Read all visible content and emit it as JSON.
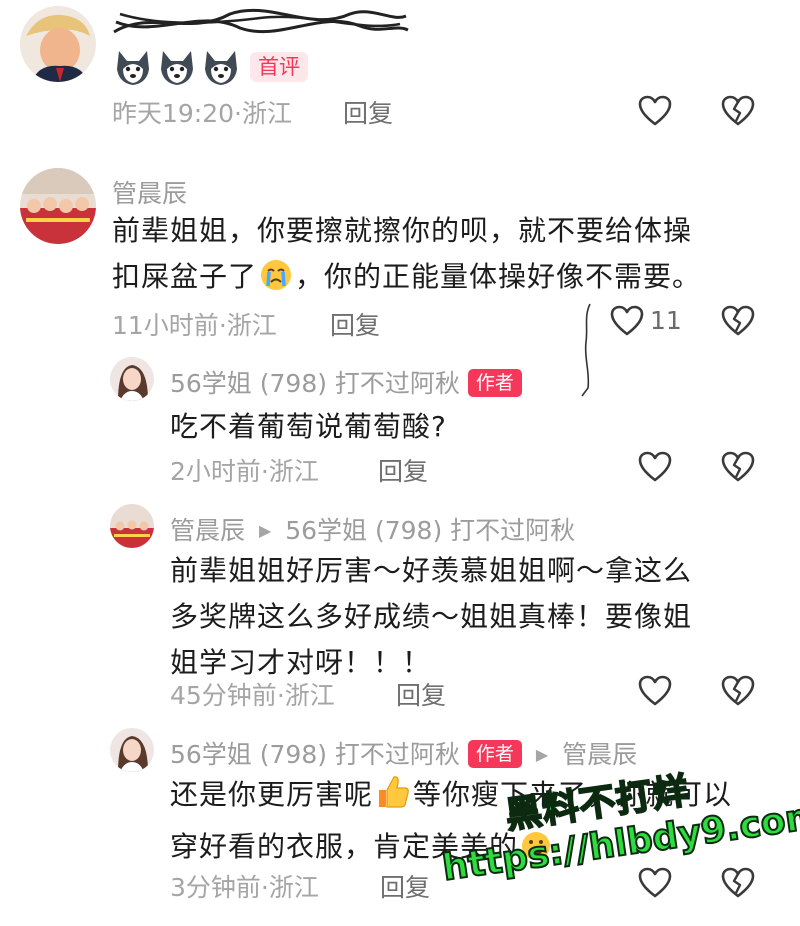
{
  "comments": [
    {
      "badge": "首评",
      "meta": {
        "time": "昨天19:20",
        "sep": "·",
        "location": "浙江"
      },
      "reply_label": "回复"
    },
    {
      "username": "管晨辰",
      "text_line1": "前辈姐姐，你要擦就擦你的呗，就不要给体操",
      "text_line2a": "扣屎盆子了",
      "text_line2b": "，你的正能量体操好像不需要。",
      "meta": {
        "time": "11小时前",
        "sep": "·",
        "location": "浙江"
      },
      "reply_label": "回复",
      "like_count": "11"
    }
  ],
  "replies": [
    {
      "username": "56学姐 (798) 打不过阿秋",
      "author_badge": "作者",
      "text": "吃不着葡萄说葡萄酸?",
      "meta": {
        "time": "2小时前",
        "sep": "·",
        "location": "浙江"
      },
      "reply_label": "回复"
    },
    {
      "username": "管晨辰",
      "reply_to": "56学姐 (798) 打不过阿秋",
      "text_line1": "前辈姐姐好厉害～好羡慕姐姐啊～拿这么",
      "text_line2": "多奖牌这么多好成绩～姐姐真棒！要像姐",
      "text_line3": "姐学习才对呀！！！",
      "meta": {
        "time": "45分钟前",
        "sep": "·",
        "location": "浙江"
      },
      "reply_label": "回复"
    },
    {
      "username": "56学姐 (798) 打不过阿秋",
      "author_badge": "作者",
      "reply_to": "管晨辰",
      "text_line1a": "还是你更厉害呢",
      "text_line1b": "等你瘦下来了，你就可以",
      "text_line2": "穿好看的衣服，肯定美美的",
      "meta": {
        "time": "3分钟前",
        "sep": "·",
        "location": "浙江"
      },
      "reply_label": "回复"
    }
  ],
  "watermark": {
    "line1": "黑料不打烊",
    "line2": "https://hlbdy9.com"
  },
  "colors": {
    "author_badge": "#f5385a",
    "first_badge": "#f5385a",
    "meta_text": "#a5a5a5",
    "watermark_fill": "#2ddc3e"
  }
}
